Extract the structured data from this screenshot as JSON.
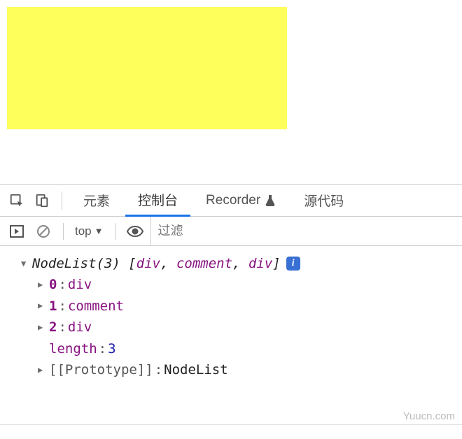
{
  "tabs": {
    "elements": "元素",
    "console": "控制台",
    "recorder": "Recorder",
    "sources": "源代码"
  },
  "toolbar": {
    "context": "top",
    "filter_placeholder": "过滤"
  },
  "console": {
    "header_type": "NodeList(3)",
    "header_preview": [
      "div",
      "comment",
      "div"
    ],
    "items": [
      {
        "index": "0",
        "value": "div"
      },
      {
        "index": "1",
        "value": "comment"
      },
      {
        "index": "2",
        "value": "div"
      }
    ],
    "length_key": "length",
    "length_value": "3",
    "prototype_key": "[[Prototype]]",
    "prototype_value": "NodeList"
  },
  "watermark": "Yuucn.com"
}
